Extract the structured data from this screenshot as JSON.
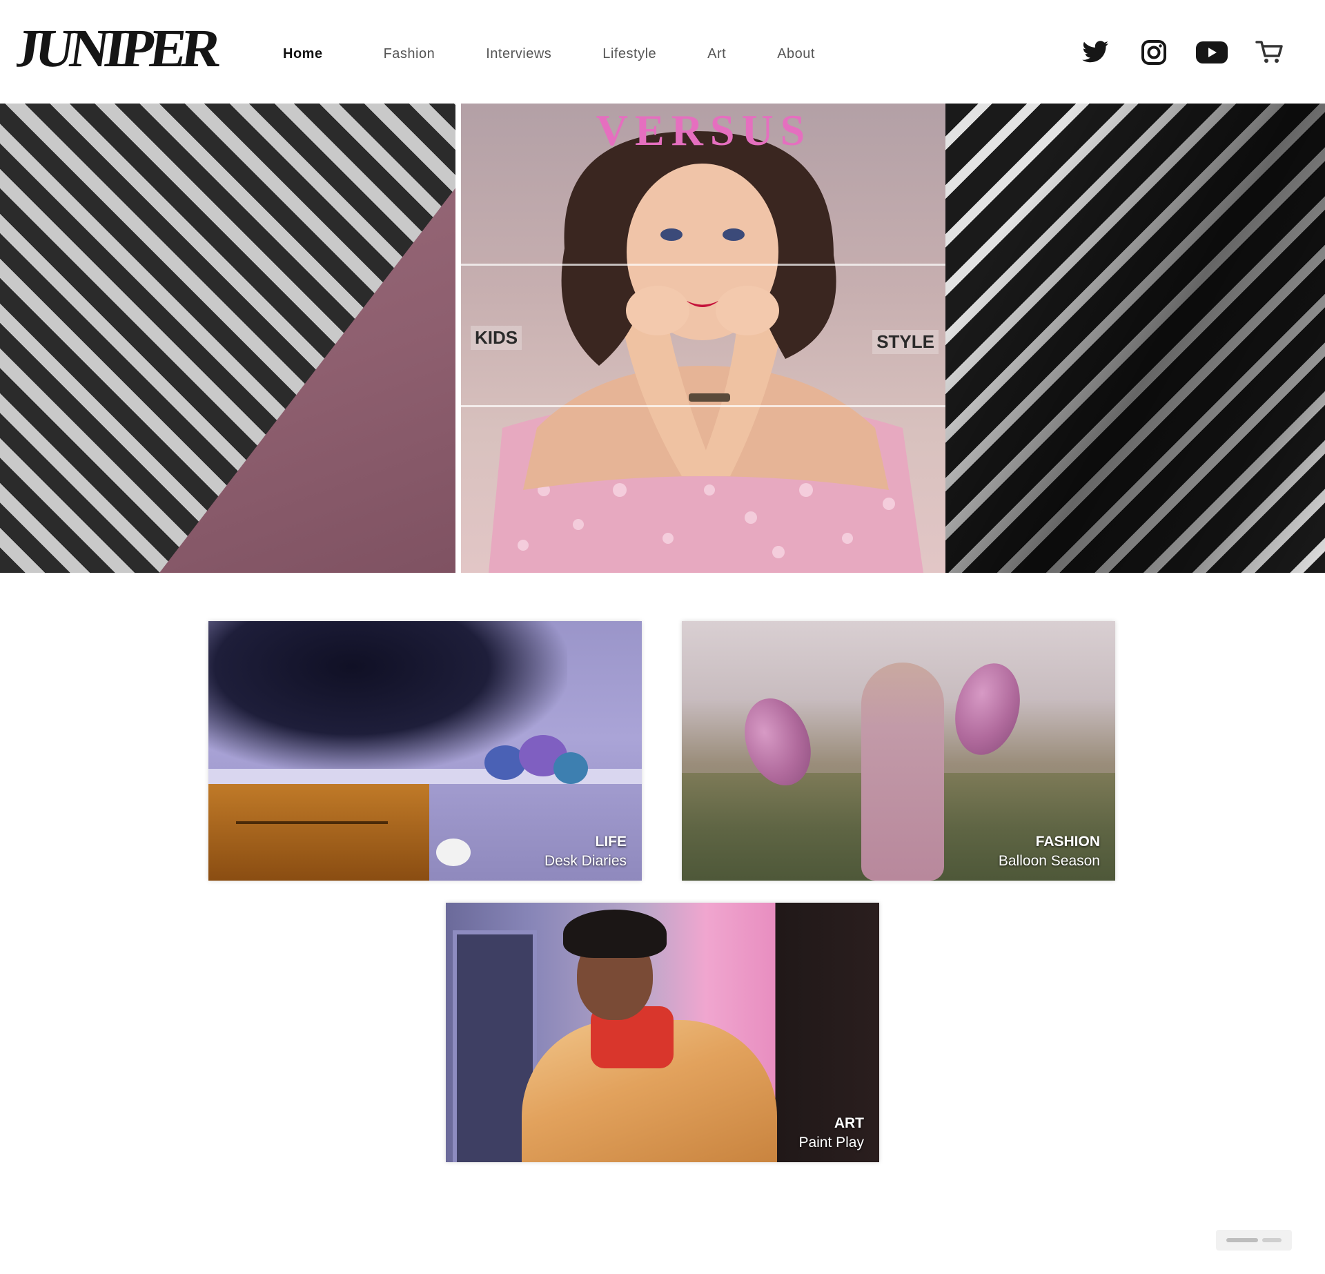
{
  "header": {
    "logo_text": "JUNIPER",
    "nav": [
      {
        "label": "Home",
        "active": true
      },
      {
        "label": "Fashion",
        "active": false
      },
      {
        "label": "Interviews",
        "active": false
      },
      {
        "label": "Lifestyle",
        "active": false
      },
      {
        "label": "Art",
        "active": false
      },
      {
        "label": "About",
        "active": false
      }
    ],
    "social": [
      {
        "icon": "twitter-icon"
      },
      {
        "icon": "instagram-icon"
      },
      {
        "icon": "youtube-icon"
      },
      {
        "icon": "cart-icon"
      }
    ]
  },
  "hero": {
    "magazine_title": "VERSUS",
    "cover_tags": [
      "KIDS",
      "STYLE"
    ]
  },
  "cards": [
    {
      "kicker": "LIFE",
      "title": "Desk Diaries"
    },
    {
      "kicker": "FASHION",
      "title": "Balloon Season"
    },
    {
      "kicker": "ART",
      "title": "Paint Play"
    }
  ],
  "colors": {
    "accent_pink": "#e56fbf",
    "text_dark": "#1a1a1a",
    "background": "#ffffff"
  }
}
